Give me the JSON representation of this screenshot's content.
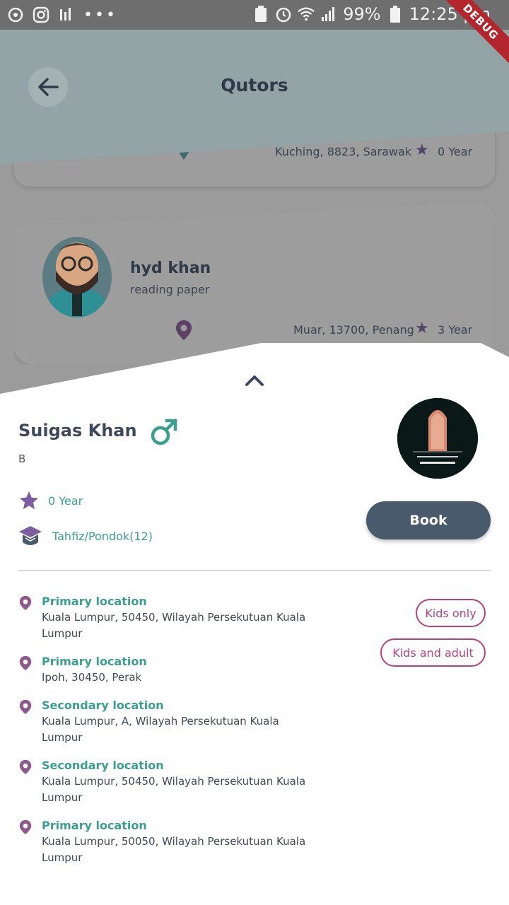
{
  "status_bar": {
    "battery": "99%",
    "time": "12:25 pm",
    "debug_label": "DEBUG"
  },
  "app_bar": {
    "title": "Qutors"
  },
  "background_cards": [
    {
      "location": "Kuching, 8823, Sarawak",
      "experience": "0 Year"
    },
    {
      "name": "hyd khan",
      "subtitle": "reading paper",
      "location": "Muar, 13700, Penang",
      "experience": "3 Year"
    }
  ],
  "sheet": {
    "name": "Suigas Khan",
    "subtitle": "B",
    "experience": "0 Year",
    "education": "Tahfiz/Pondok(12)",
    "book_label": "Book",
    "locations": [
      {
        "title": "Primary location",
        "address": "Kuala Lumpur, 50450, Wilayah Persekutuan Kuala Lumpur"
      },
      {
        "title": "Primary location",
        "address": "Ipoh, 30450, Perak"
      },
      {
        "title": "Secondary location",
        "address": "Kuala Lumpur, A, Wilayah Persekutuan Kuala Lumpur"
      },
      {
        "title": "Secondary location",
        "address": "Kuala Lumpur, 50450, Wilayah Persekutuan Kuala Lumpur"
      },
      {
        "title": "Primary location",
        "address": "Kuala Lumpur, 50050, Wilayah Persekutuan Kuala Lumpur"
      }
    ],
    "tags": [
      "Kids only",
      "Kids and adult"
    ]
  },
  "colors": {
    "accent_teal": "#3b9e8f",
    "pin_purple": "#8e5a8e",
    "star_purple": "#7b5fa0",
    "tag_magenta": "#b5427e",
    "button_slate": "#4a5a6d"
  }
}
